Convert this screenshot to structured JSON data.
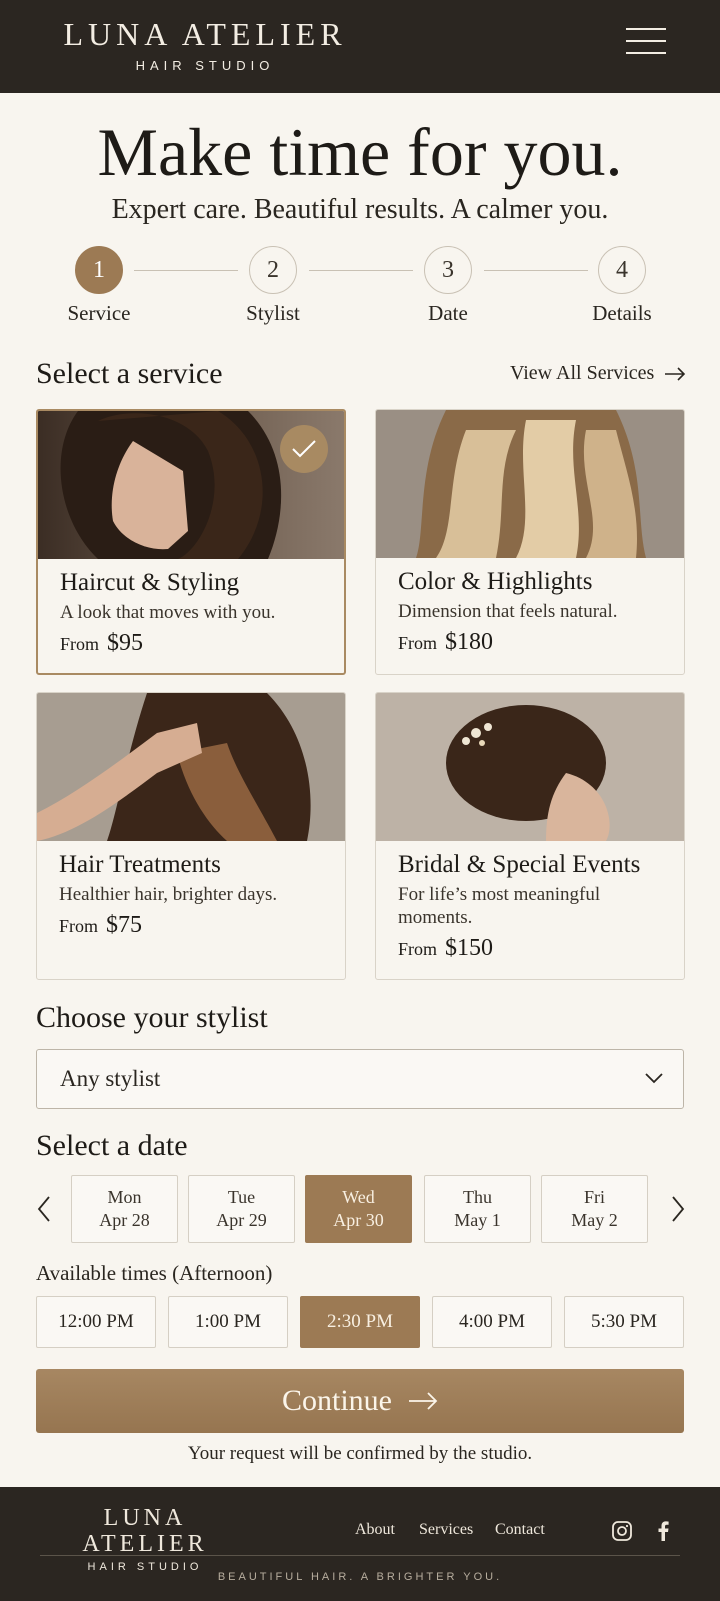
{
  "header": {
    "brand_name": "LUNA ATELIER",
    "brand_sub": "HAIR STUDIO",
    "menu_icon": "hamburger-menu-icon"
  },
  "hero": {
    "title": "Make time for you.",
    "subtitle": "Expert care. Beautiful results. A calmer you."
  },
  "steps": [
    {
      "number": "1",
      "label": "Service",
      "active": true
    },
    {
      "number": "2",
      "label": "Stylist",
      "active": false
    },
    {
      "number": "3",
      "label": "Date",
      "active": false
    },
    {
      "number": "4",
      "label": "Details",
      "active": false
    }
  ],
  "services": {
    "title": "Select a service",
    "view_all": "View All Services",
    "items": [
      {
        "title": "Haircut & Styling",
        "desc": "A look that moves with you.",
        "from": "From",
        "price": "$95",
        "selected": true,
        "image": "woman-wavy-brunette-hair-profile"
      },
      {
        "title": "Color & Highlights",
        "desc": "Dimension that feels natural.",
        "from": "From",
        "price": "$180",
        "selected": false,
        "image": "blonde-balayage-waves"
      },
      {
        "title": "Hair Treatments",
        "desc": "Healthier hair, brighter days.",
        "from": "From",
        "price": "$75",
        "selected": false,
        "image": "hand-in-glossy-brown-hair"
      },
      {
        "title": "Bridal & Special Events",
        "desc": "For life’s most meaningful moments.",
        "from": "From",
        "price": "$150",
        "selected": false,
        "image": "bridal-updo-with-hairpiece"
      }
    ]
  },
  "stylist": {
    "title": "Choose your stylist",
    "value": "Any stylist"
  },
  "date": {
    "title": "Select a date",
    "days": [
      {
        "day": "Mon",
        "date": "Apr 28",
        "active": false
      },
      {
        "day": "Tue",
        "date": "Apr 29",
        "active": false
      },
      {
        "day": "Wed",
        "date": "Apr 30",
        "active": true
      },
      {
        "day": "Thu",
        "date": "May 1",
        "active": false
      },
      {
        "day": "Fri",
        "date": "May 2",
        "active": false
      }
    ]
  },
  "times": {
    "label": "Available times (Afternoon)",
    "slots": [
      {
        "time": "12:00 PM",
        "active": false
      },
      {
        "time": "1:00 PM",
        "active": false
      },
      {
        "time": "2:30 PM",
        "active": true
      },
      {
        "time": "4:00 PM",
        "active": false
      },
      {
        "time": "5:30 PM",
        "active": false
      }
    ]
  },
  "cta": {
    "label": "Continue",
    "note": "Your request will be confirmed by the studio."
  },
  "footer": {
    "brand_name": "LUNA ATELIER",
    "brand_sub": "HAIR STUDIO",
    "links": [
      "About",
      "Services",
      "Contact"
    ],
    "social_icons": [
      "instagram-icon",
      "facebook-icon"
    ],
    "tagline": "BEAUTIFUL HAIR. A BRIGHTER YOU."
  },
  "colors": {
    "header_bg": "#2b2621",
    "accent": "#9c7a54",
    "page_bg": "#f8f5ef"
  }
}
